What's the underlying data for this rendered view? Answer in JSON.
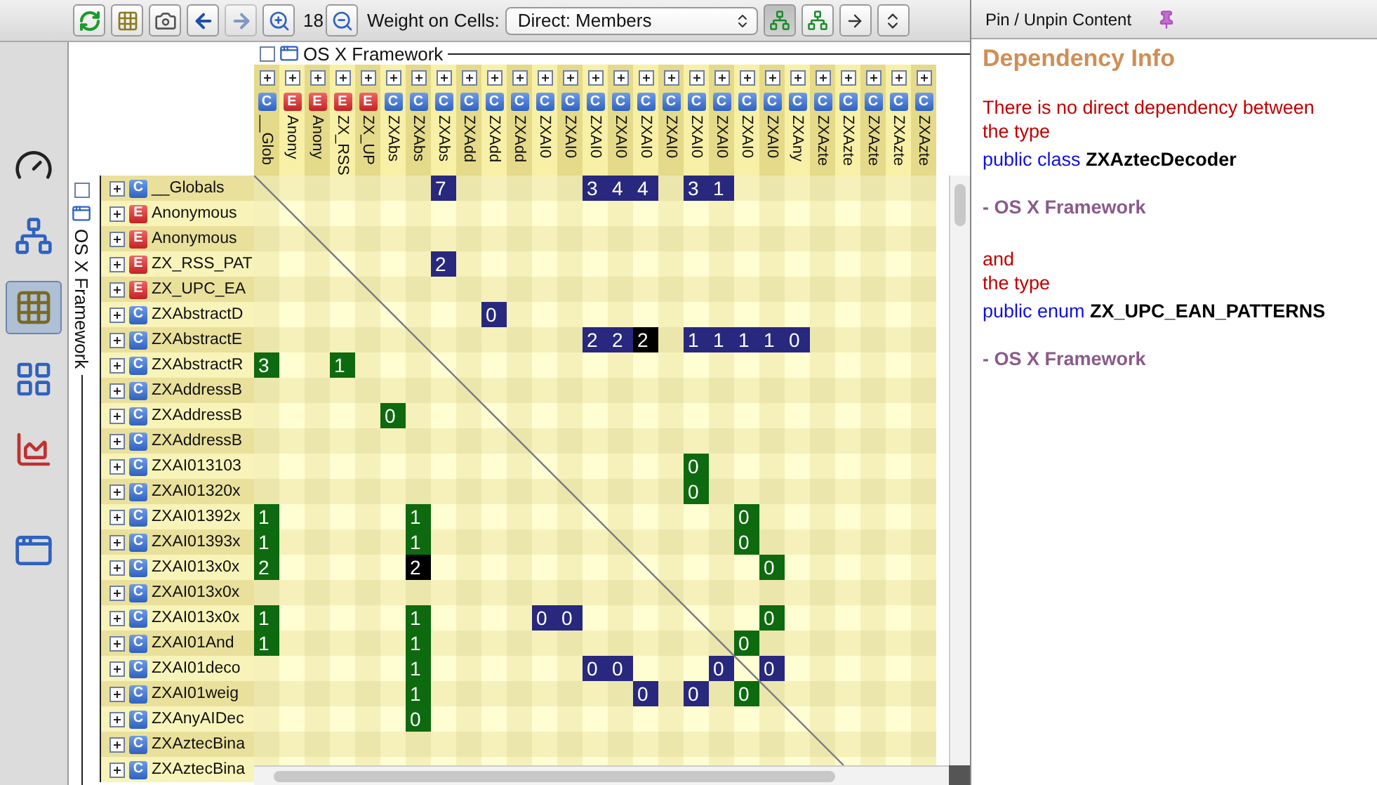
{
  "toolbar": {
    "navigation": [
      {
        "disabled": false
      },
      {
        "disabled": true
      }
    ],
    "zoom_value": "18",
    "weight_label": "Weight on Cells:",
    "weight_select": "Direct: Members",
    "view_toggles": [
      {
        "selected": true
      },
      {
        "selected": false
      }
    ]
  },
  "sidebar": {
    "items": [
      {
        "selected": false
      },
      {
        "selected": false
      },
      {
        "selected": true
      },
      {
        "selected": false
      },
      {
        "selected": false
      },
      {
        "selected": false
      }
    ]
  },
  "matrix": {
    "column_group": "OS X Framework",
    "row_group": "OS X Framework",
    "columns": [
      {
        "badge": "C",
        "kind": "class",
        "name": "__Glob"
      },
      {
        "badge": "E",
        "kind": "enum",
        "name": "Anony"
      },
      {
        "badge": "E",
        "kind": "enum",
        "name": "Anony"
      },
      {
        "badge": "E",
        "kind": "enum",
        "name": "ZX_RSS"
      },
      {
        "badge": "E",
        "kind": "enum",
        "name": "ZX_UP"
      },
      {
        "badge": "C",
        "kind": "class",
        "name": "ZXAbs"
      },
      {
        "badge": "C",
        "kind": "class",
        "name": "ZXAbs"
      },
      {
        "badge": "C",
        "kind": "class",
        "name": "ZXAbs"
      },
      {
        "badge": "C",
        "kind": "class",
        "name": "ZXAdd"
      },
      {
        "badge": "C",
        "kind": "class",
        "name": "ZXAdd"
      },
      {
        "badge": "C",
        "kind": "class",
        "name": "ZXAdd"
      },
      {
        "badge": "C",
        "kind": "class",
        "name": "ZXAI0"
      },
      {
        "badge": "C",
        "kind": "class",
        "name": "ZXAI0"
      },
      {
        "badge": "C",
        "kind": "class",
        "name": "ZXAI0"
      },
      {
        "badge": "C",
        "kind": "class",
        "name": "ZXAI0"
      },
      {
        "badge": "C",
        "kind": "class",
        "name": "ZXAI0"
      },
      {
        "badge": "C",
        "kind": "class",
        "name": "ZXAI0"
      },
      {
        "badge": "C",
        "kind": "class",
        "name": "ZXAI0"
      },
      {
        "badge": "C",
        "kind": "class",
        "name": "ZXAI0"
      },
      {
        "badge": "C",
        "kind": "class",
        "name": "ZXAI0"
      },
      {
        "badge": "C",
        "kind": "class",
        "name": "ZXAI0"
      },
      {
        "badge": "C",
        "kind": "class",
        "name": "ZXAny"
      },
      {
        "badge": "C",
        "kind": "class",
        "name": "ZXAzte"
      },
      {
        "badge": "C",
        "kind": "class",
        "name": "ZXAzte"
      },
      {
        "badge": "C",
        "kind": "class",
        "name": "ZXAzte"
      },
      {
        "badge": "C",
        "kind": "class",
        "name": "ZXAzte"
      },
      {
        "badge": "C",
        "kind": "class",
        "name": "ZXAzte"
      }
    ],
    "rows": [
      {
        "badge": "C",
        "kind": "class",
        "name": "__Globals",
        "cells": [
          null,
          null,
          null,
          null,
          null,
          null,
          null,
          {
            "value": "7",
            "color": "#28287e"
          },
          null,
          null,
          null,
          null,
          null,
          {
            "value": "3",
            "color": "#28287e"
          },
          {
            "value": "4",
            "color": "#28287e"
          },
          {
            "value": "4",
            "color": "#28287e"
          },
          null,
          {
            "value": "3",
            "color": "#28287e"
          },
          {
            "value": "1",
            "color": "#28287e"
          }
        ]
      },
      {
        "badge": "E",
        "kind": "enum",
        "name": "Anonymous"
      },
      {
        "badge": "E",
        "kind": "enum",
        "name": "Anonymous"
      },
      {
        "badge": "E",
        "kind": "enum",
        "name": "ZX_RSS_PAT",
        "cells": [
          null,
          null,
          null,
          null,
          null,
          null,
          null,
          {
            "value": "2",
            "color": "#28287e"
          }
        ]
      },
      {
        "badge": "E",
        "kind": "enum",
        "name": "ZX_UPC_EA"
      },
      {
        "badge": "C",
        "kind": "class",
        "name": "ZXAbstractD",
        "cells": [
          null,
          null,
          null,
          null,
          null,
          null,
          null,
          null,
          null,
          {
            "value": "0",
            "color": "#28287e"
          }
        ]
      },
      {
        "badge": "C",
        "kind": "class",
        "name": "ZXAbstractE",
        "cells": [
          null,
          null,
          null,
          null,
          null,
          null,
          null,
          null,
          null,
          null,
          null,
          null,
          null,
          {
            "value": "2",
            "color": "#28287e"
          },
          {
            "value": "2",
            "color": "#28287e"
          },
          {
            "value": "2",
            "color": "#000000"
          },
          null,
          {
            "value": "1",
            "color": "#28287e"
          },
          {
            "value": "1",
            "color": "#28287e"
          },
          {
            "value": "1",
            "color": "#28287e"
          },
          {
            "value": "1",
            "color": "#28287e"
          },
          {
            "value": "0",
            "color": "#28287e"
          }
        ]
      },
      {
        "badge": "C",
        "kind": "class",
        "name": "ZXAbstractR",
        "cells": [
          {
            "value": "3",
            "color": "#0e6a0e"
          },
          null,
          null,
          {
            "value": "1",
            "color": "#0e6a0e"
          }
        ]
      },
      {
        "badge": "C",
        "kind": "class",
        "name": "ZXAddressB"
      },
      {
        "badge": "C",
        "kind": "class",
        "name": "ZXAddressB",
        "cells": [
          null,
          null,
          null,
          null,
          null,
          {
            "value": "0",
            "color": "#0e6a0e"
          }
        ]
      },
      {
        "badge": "C",
        "kind": "class",
        "name": "ZXAddressB"
      },
      {
        "badge": "C",
        "kind": "class",
        "name": "ZXAI013103",
        "cells": [
          null,
          null,
          null,
          null,
          null,
          null,
          null,
          null,
          null,
          null,
          null,
          null,
          null,
          null,
          null,
          null,
          null,
          {
            "value": "0",
            "color": "#0e6a0e"
          }
        ]
      },
      {
        "badge": "C",
        "kind": "class",
        "name": "ZXAI01320x",
        "cells": [
          null,
          null,
          null,
          null,
          null,
          null,
          null,
          null,
          null,
          null,
          null,
          null,
          null,
          null,
          null,
          null,
          null,
          {
            "value": "0",
            "color": "#0e6a0e"
          }
        ]
      },
      {
        "badge": "C",
        "kind": "class",
        "name": "ZXAI01392x",
        "cells": [
          {
            "value": "1",
            "color": "#0e6a0e"
          },
          null,
          null,
          null,
          null,
          null,
          {
            "value": "1",
            "color": "#0e6a0e"
          },
          null,
          null,
          null,
          null,
          null,
          null,
          null,
          null,
          null,
          null,
          null,
          null,
          {
            "value": "0",
            "color": "#0e6a0e"
          }
        ]
      },
      {
        "badge": "C",
        "kind": "class",
        "name": "ZXAI01393x",
        "cells": [
          {
            "value": "1",
            "color": "#0e6a0e"
          },
          null,
          null,
          null,
          null,
          null,
          {
            "value": "1",
            "color": "#0e6a0e"
          },
          null,
          null,
          null,
          null,
          null,
          null,
          null,
          null,
          null,
          null,
          null,
          null,
          {
            "value": "0",
            "color": "#0e6a0e"
          }
        ]
      },
      {
        "badge": "C",
        "kind": "class",
        "name": "ZXAI013x0x",
        "cells": [
          {
            "value": "2",
            "color": "#0e6a0e"
          },
          null,
          null,
          null,
          null,
          null,
          {
            "value": "2",
            "color": "#000000"
          },
          null,
          null,
          null,
          null,
          null,
          null,
          null,
          null,
          null,
          null,
          null,
          null,
          null,
          {
            "value": "0",
            "color": "#0e6a0e"
          }
        ]
      },
      {
        "badge": "C",
        "kind": "class",
        "name": "ZXAI013x0x"
      },
      {
        "badge": "C",
        "kind": "class",
        "name": "ZXAI013x0x",
        "cells": [
          {
            "value": "1",
            "color": "#0e6a0e"
          },
          null,
          null,
          null,
          null,
          null,
          {
            "value": "1",
            "color": "#0e6a0e"
          },
          null,
          null,
          null,
          null,
          {
            "value": "0",
            "color": "#28287e"
          },
          {
            "value": "0",
            "color": "#28287e"
          },
          null,
          null,
          null,
          null,
          null,
          null,
          null,
          {
            "value": "0",
            "color": "#0e6a0e"
          }
        ]
      },
      {
        "badge": "C",
        "kind": "class",
        "name": "ZXAI01And",
        "cells": [
          {
            "value": "1",
            "color": "#0e6a0e"
          },
          null,
          null,
          null,
          null,
          null,
          {
            "value": "1",
            "color": "#0e6a0e"
          },
          null,
          null,
          null,
          null,
          null,
          null,
          null,
          null,
          null,
          null,
          null,
          null,
          {
            "value": "0",
            "color": "#0e6a0e"
          }
        ]
      },
      {
        "badge": "C",
        "kind": "class",
        "name": "ZXAI01deco",
        "cells": [
          null,
          null,
          null,
          null,
          null,
          null,
          {
            "value": "1",
            "color": "#0e6a0e"
          },
          null,
          null,
          null,
          null,
          null,
          null,
          {
            "value": "0",
            "color": "#28287e"
          },
          {
            "value": "0",
            "color": "#28287e"
          },
          null,
          null,
          null,
          {
            "value": "0",
            "color": "#28287e"
          },
          null,
          {
            "value": "0",
            "color": "#28287e"
          }
        ]
      },
      {
        "badge": "C",
        "kind": "class",
        "name": "ZXAI01weig",
        "cells": [
          null,
          null,
          null,
          null,
          null,
          null,
          {
            "value": "1",
            "color": "#0e6a0e"
          },
          null,
          null,
          null,
          null,
          null,
          null,
          null,
          null,
          {
            "value": "0",
            "color": "#28287e"
          },
          null,
          {
            "value": "0",
            "color": "#28287e"
          },
          null,
          {
            "value": "0",
            "color": "#0e6a0e"
          }
        ]
      },
      {
        "badge": "C",
        "kind": "class",
        "name": "ZXAnyAIDec",
        "cells": [
          null,
          null,
          null,
          null,
          null,
          null,
          {
            "value": "0",
            "color": "#0e6a0e"
          }
        ]
      },
      {
        "badge": "C",
        "kind": "class",
        "name": "ZXAztecBina"
      },
      {
        "badge": "C",
        "kind": "class",
        "name": "ZXAztecBina"
      }
    ]
  },
  "info": {
    "pin_label": "Pin / Unpin Content",
    "title": "Dependency Info",
    "lines": [
      {
        "kind": "note",
        "text": "There is no direct dependency between the type"
      },
      {
        "kind": "declaration",
        "text": "public class **ZXAztecDecoder**"
      },
      {
        "kind": "location",
        "text": "- OS X Framework"
      },
      {
        "kind": "note",
        "text": "and"
      },
      {
        "kind": "note",
        "text": "the type"
      },
      {
        "kind": "declaration",
        "text": "public enum **ZX_UPC_EAN_PATTERNS**"
      },
      {
        "kind": "location",
        "text": "- OS X Framework"
      }
    ]
  }
}
